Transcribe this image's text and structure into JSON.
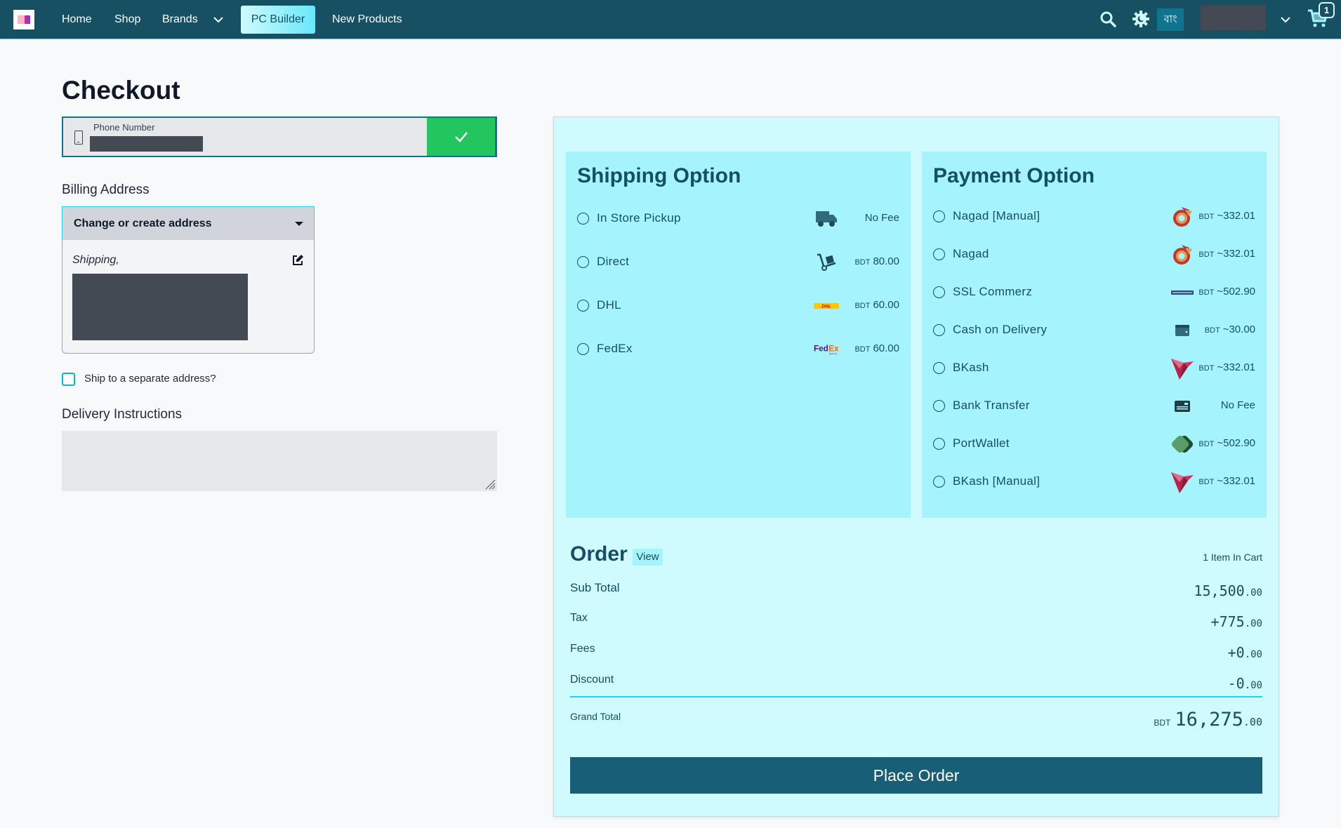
{
  "nav": {
    "logo_alt": "Store logo",
    "links": [
      "Home",
      "Shop",
      "Brands"
    ],
    "pc_builder": "PC Builder",
    "new_products": "New Products",
    "language": "বাং",
    "cart_count": "1",
    "icons": {
      "search": "search-icon",
      "theme": "theme-toggle-icon",
      "cart": "cart-icon",
      "chevron": "chevron-down-icon"
    }
  },
  "checkout": {
    "title": "Checkout",
    "phone": {
      "label": "Phone Number",
      "value": "",
      "confirm_icon": "check-icon"
    },
    "billing_label": "Billing Address",
    "address_select": "Change or create address",
    "address_card_title": "Shipping,",
    "ship_separate": "Ship to a separate address?",
    "ship_separate_checked": false,
    "delivery_label": "Delivery Instructions",
    "delivery_value": ""
  },
  "shipping": {
    "title": "Shipping Option",
    "options": [
      {
        "label": "In Store Pickup",
        "icon": "truck-icon",
        "currency": "",
        "fee": "No Fee"
      },
      {
        "label": "Direct",
        "icon": "hand-truck-icon",
        "currency": "BDT",
        "fee": "80.00"
      },
      {
        "label": "DHL",
        "icon": "dhl-logo-icon",
        "currency": "BDT",
        "fee": "60.00"
      },
      {
        "label": "FedEx",
        "icon": "fedex-logo-icon",
        "currency": "BDT",
        "fee": "60.00"
      }
    ]
  },
  "payment": {
    "title": "Payment Option",
    "options": [
      {
        "label": "Nagad [Manual]",
        "icon": "nagad-logo-icon",
        "currency": "BDT",
        "fee": "~332.01"
      },
      {
        "label": "Nagad",
        "icon": "nagad-logo-icon",
        "currency": "BDT",
        "fee": "~332.01"
      },
      {
        "label": "SSL Commerz",
        "icon": "sslcommerz-logo-icon",
        "currency": "BDT",
        "fee": "~502.90"
      },
      {
        "label": "Cash on Delivery",
        "icon": "wallet-icon",
        "currency": "BDT",
        "fee": "~30.00"
      },
      {
        "label": "BKash",
        "icon": "bkash-logo-icon",
        "currency": "BDT",
        "fee": "~332.01"
      },
      {
        "label": "Bank Transfer",
        "icon": "bank-card-icon",
        "currency": "",
        "fee": "No Fee"
      },
      {
        "label": "PortWallet",
        "icon": "portwallet-logo-icon",
        "currency": "BDT",
        "fee": "~502.90"
      },
      {
        "label": "BKash [Manual]",
        "icon": "bkash-logo-icon",
        "currency": "BDT",
        "fee": "~332.01"
      }
    ]
  },
  "order": {
    "title": "Order",
    "view_label": "View",
    "cart_count_text": "1 Item In Cart",
    "rows": [
      {
        "label": "Sub Total",
        "sign": "",
        "int": "15,500",
        "dec": ".00"
      },
      {
        "label": "Tax",
        "sign": "+",
        "int": "775",
        "dec": ".00"
      },
      {
        "label": "Fees",
        "sign": "+",
        "int": "0",
        "dec": ".00"
      },
      {
        "label": "Discount",
        "sign": "-",
        "int": "0",
        "dec": ".00"
      }
    ],
    "grand_total": {
      "label": "Grand Total",
      "currency": "BDT",
      "int": "16,275",
      "dec": ".00"
    },
    "place_order": "Place Order"
  },
  "colors": {
    "nav_bg": "#174f63",
    "accent": "#22d3ee",
    "panel_bg": "#a5f3fc",
    "wrap_bg": "#cffafe",
    "confirm": "#22c55e",
    "primary_button": "#175e76"
  }
}
